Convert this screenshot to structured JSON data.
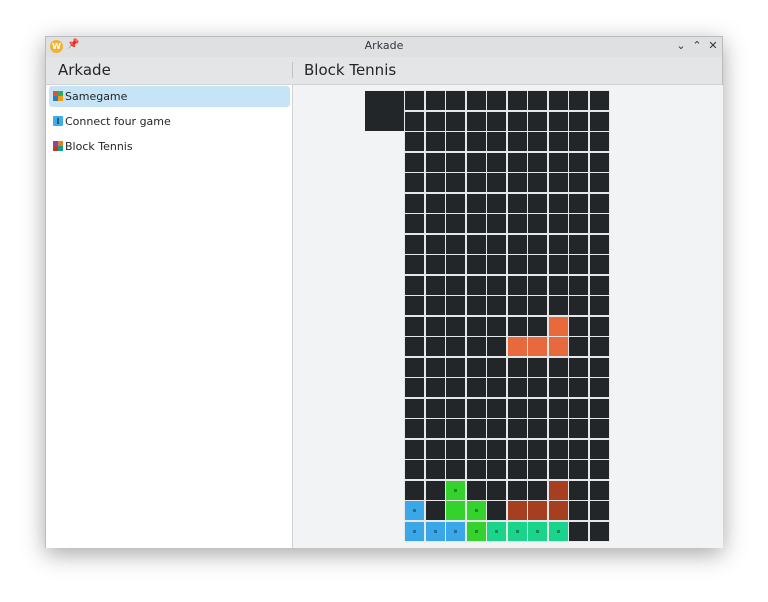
{
  "window": {
    "title": "Arkade",
    "app_icon_letter": "W",
    "buttons": {
      "minimize": "⌄",
      "maximize": "⌃",
      "close": "✕"
    }
  },
  "header": {
    "app_title": "Arkade",
    "page_title": "Block Tennis"
  },
  "sidebar": {
    "items": [
      {
        "label": "Samegame",
        "selected": true,
        "icon": "samegame-icon"
      },
      {
        "label": "Connect four game",
        "selected": false,
        "icon": "connect-four-icon"
      },
      {
        "label": "Block Tennis",
        "selected": false,
        "icon": "block-tennis-icon"
      }
    ]
  },
  "game": {
    "name": "Block Tennis",
    "colors": {
      "empty": "#232629",
      "grid": "#e6e7e8",
      "orange": "#e86a3c",
      "green": "#33d22c",
      "teal": "#19d48a",
      "blue": "#3aa8e8",
      "brown": "#a63f1f"
    },
    "next_piece_cell": {
      "row": 0,
      "col": 0,
      "color": "empty",
      "size": 2
    },
    "board": {
      "rows": 22,
      "cols": 10,
      "filled": [
        {
          "r": 11,
          "c": 7,
          "color": "orange"
        },
        {
          "r": 12,
          "c": 5,
          "color": "orange"
        },
        {
          "r": 12,
          "c": 6,
          "color": "orange"
        },
        {
          "r": 12,
          "c": 7,
          "color": "orange"
        },
        {
          "r": 19,
          "c": 2,
          "color": "green",
          "dot": true
        },
        {
          "r": 19,
          "c": 7,
          "color": "brown"
        },
        {
          "r": 20,
          "c": 0,
          "color": "blue",
          "dot": true
        },
        {
          "r": 20,
          "c": 2,
          "color": "green"
        },
        {
          "r": 20,
          "c": 3,
          "color": "green",
          "dot": true
        },
        {
          "r": 20,
          "c": 5,
          "color": "brown"
        },
        {
          "r": 20,
          "c": 6,
          "color": "brown"
        },
        {
          "r": 20,
          "c": 7,
          "color": "brown"
        },
        {
          "r": 21,
          "c": 0,
          "color": "blue",
          "dot": true
        },
        {
          "r": 21,
          "c": 1,
          "color": "blue",
          "dot": true
        },
        {
          "r": 21,
          "c": 2,
          "color": "blue",
          "dot": true
        },
        {
          "r": 21,
          "c": 3,
          "color": "green",
          "dot": true
        },
        {
          "r": 21,
          "c": 4,
          "color": "teal",
          "dot": true
        },
        {
          "r": 21,
          "c": 5,
          "color": "teal",
          "dot": true
        },
        {
          "r": 21,
          "c": 6,
          "color": "teal",
          "dot": true
        },
        {
          "r": 21,
          "c": 7,
          "color": "teal",
          "dot": true
        }
      ]
    }
  }
}
